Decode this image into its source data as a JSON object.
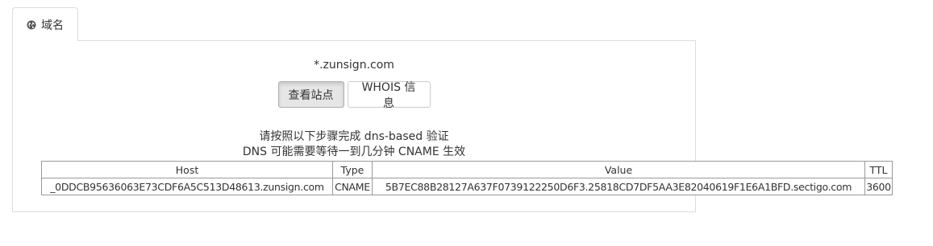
{
  "tab": {
    "label": "域名",
    "icon": "globe-icon"
  },
  "domain": "*.zunsign.com",
  "buttons": {
    "view_site": "查看站点",
    "whois": "WHOIS 信息"
  },
  "instructions": {
    "line1": "请按照以下步骤完成 dns-based 验证",
    "line2": "DNS 可能需要等待一到几分钟 CNAME 生效"
  },
  "table": {
    "headers": {
      "host": "Host",
      "type": "Type",
      "value": "Value",
      "ttl": "TTL"
    },
    "row": {
      "host": "_0DDCB95636063E73CDF6A5C513D48613.zunsign.com",
      "type": "CNAME",
      "value": "5B7EC88B28127A637F0739122250D6F3.25818CD7DF5AA3E82040619F1E6A1BFD.sectigo.com",
      "ttl": "3600"
    }
  }
}
